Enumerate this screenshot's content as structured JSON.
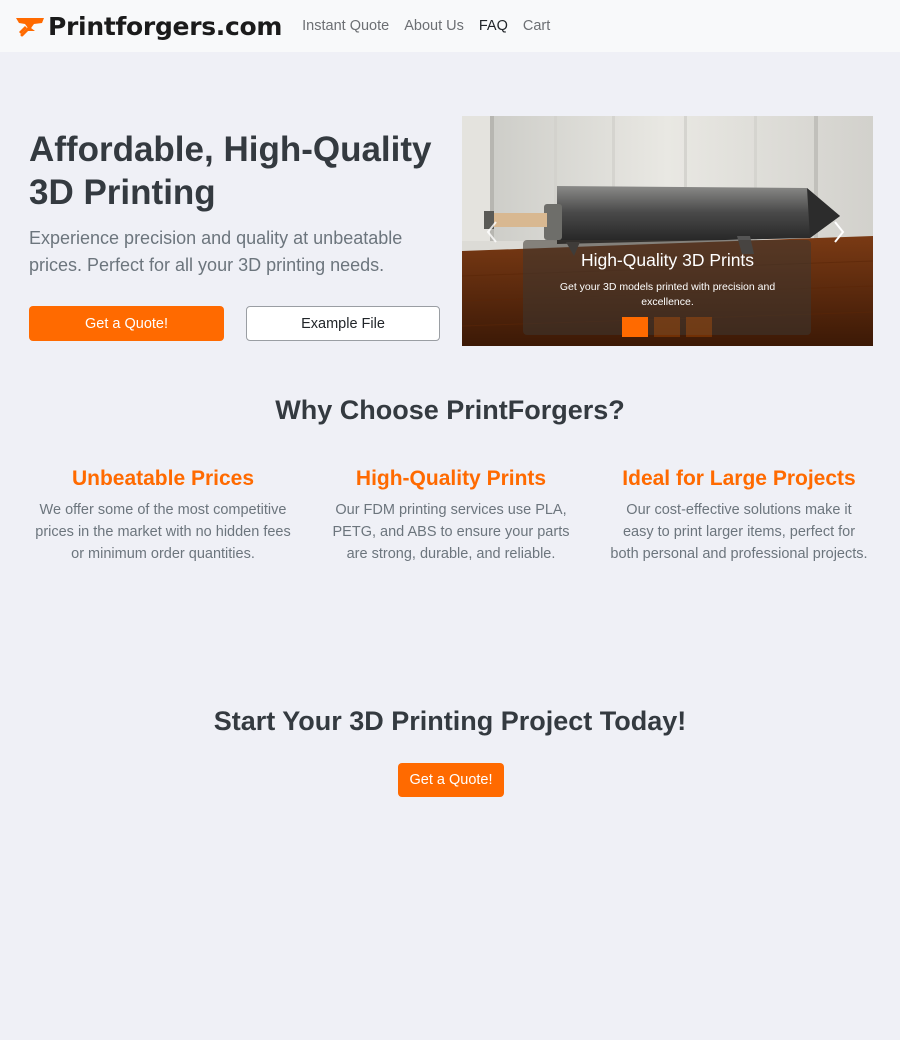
{
  "navbar": {
    "brand": "Printforgers.com",
    "logo_icon": "anvil-hammer-icon",
    "links": [
      {
        "label": "Instant Quote",
        "active": false
      },
      {
        "label": "About Us",
        "active": false
      },
      {
        "label": "FAQ",
        "active": true
      },
      {
        "label": "Cart",
        "active": false
      }
    ]
  },
  "hero": {
    "title": "Affordable, High-Quality 3D Printing",
    "text": "Experience precision and quality at unbeatable prices. Perfect for all your 3D printing needs.",
    "primary_button": "Get a Quote!",
    "secondary_button": "Example File"
  },
  "carousel": {
    "caption_title": "High-Quality 3D Prints",
    "caption_text": "Get your 3D models printed with precision and excellence.",
    "slide_count": 3,
    "active_slide": 1
  },
  "why": {
    "title": "Why Choose PrintForgers?",
    "features": [
      {
        "title": "Unbeatable Prices",
        "text": "We offer some of the most competitive prices in the market with no hidden fees or minimum order quantities."
      },
      {
        "title": "High-Quality Prints",
        "text": "Our FDM printing services use PLA, PETG, and ABS to ensure your parts are strong, durable, and reliable."
      },
      {
        "title": "Ideal for Large Projects",
        "text": "Our cost-effective solutions make it easy to print larger items, perfect for both personal and professional projects."
      }
    ]
  },
  "cta": {
    "title": "Start Your 3D Printing Project Today!",
    "button": "Get a Quote!"
  },
  "colors": {
    "accent": "#ff6a00",
    "background": "#eff0f6",
    "navbar": "#f8f9fa"
  }
}
